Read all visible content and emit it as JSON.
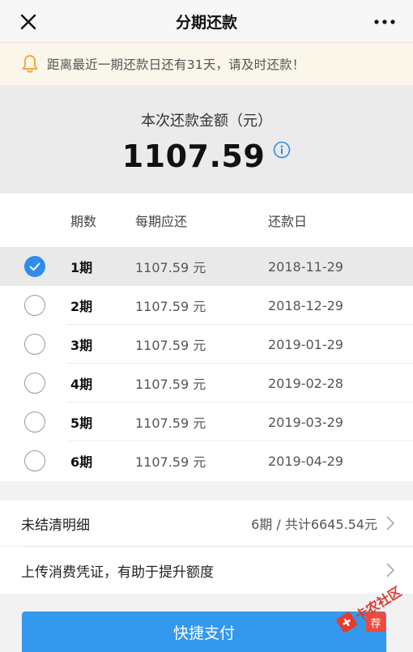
{
  "header": {
    "title": "分期还款"
  },
  "notice": {
    "text": "距离最近一期还款日还有31天，请及时还款！"
  },
  "summary": {
    "label": "本次还款金额（元）",
    "amount": "1107.59"
  },
  "table": {
    "headers": {
      "period": "期数",
      "amount": "每期应还",
      "date": "还款日"
    },
    "rows": [
      {
        "period": "1期",
        "amount": "1107.59 元",
        "date": "2018-11-29",
        "selected": true
      },
      {
        "period": "2期",
        "amount": "1107.59 元",
        "date": "2018-12-29",
        "selected": false
      },
      {
        "period": "3期",
        "amount": "1107.59 元",
        "date": "2019-01-29",
        "selected": false
      },
      {
        "period": "4期",
        "amount": "1107.59 元",
        "date": "2019-02-28",
        "selected": false
      },
      {
        "period": "5期",
        "amount": "1107.59 元",
        "date": "2019-03-29",
        "selected": false
      },
      {
        "period": "6期",
        "amount": "1107.59 元",
        "date": "2019-04-29",
        "selected": false
      }
    ]
  },
  "detail": {
    "label": "未结清明细",
    "value": "6期 / 共计6645.54元"
  },
  "upload": {
    "label": "上传消费凭证，有助于提升额度"
  },
  "pay": {
    "label": "快捷支付",
    "tag": "荐"
  },
  "watermark": {
    "text": "卡农社区"
  },
  "colors": {
    "accent": "#3399ee",
    "selected": "#2f8cea",
    "notice_bg": "#fbf6ea",
    "bell": "#f2a93b"
  },
  "icons": {
    "close": "close-icon",
    "more": "more-icon",
    "bell": "bell-icon",
    "info": "info-icon",
    "check": "check-icon",
    "chevron": "chevron-right-icon"
  }
}
